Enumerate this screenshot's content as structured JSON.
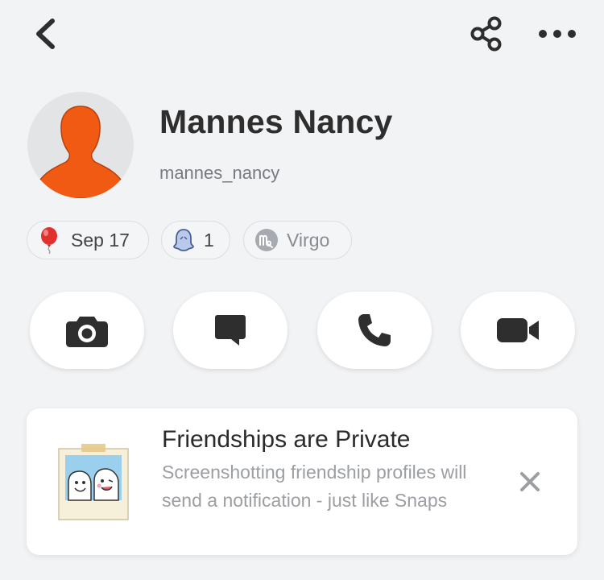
{
  "header": {
    "back_icon": "chevron-left-icon",
    "share_icon": "share-icon",
    "more_icon": "more-horizontal-icon"
  },
  "profile": {
    "display_name": "Mannes Nancy",
    "username": "mannes_nancy",
    "avatar_icon": "person-silhouette-avatar",
    "avatar_color": "#f15a13"
  },
  "chips": {
    "birthday": {
      "icon": "balloon-icon",
      "label": "Sep 17"
    },
    "charms": {
      "icon": "ghost-icon",
      "label": "1"
    },
    "zodiac": {
      "icon": "virgo-icon",
      "label": "Virgo"
    }
  },
  "actions": [
    {
      "icon": "camera-icon"
    },
    {
      "icon": "chat-icon"
    },
    {
      "icon": "phone-icon"
    },
    {
      "icon": "video-camera-icon"
    }
  ],
  "notice": {
    "title": "Friendships are Private",
    "body": "Screenshotting friendship profiles will send a notification - just like Snaps",
    "close_icon": "close-icon"
  },
  "colors": {
    "background": "#f2f3f5",
    "icon_dark": "#2e2e2e",
    "muted_text": "#9b9ea3",
    "balloon_red": "#e0312f"
  }
}
